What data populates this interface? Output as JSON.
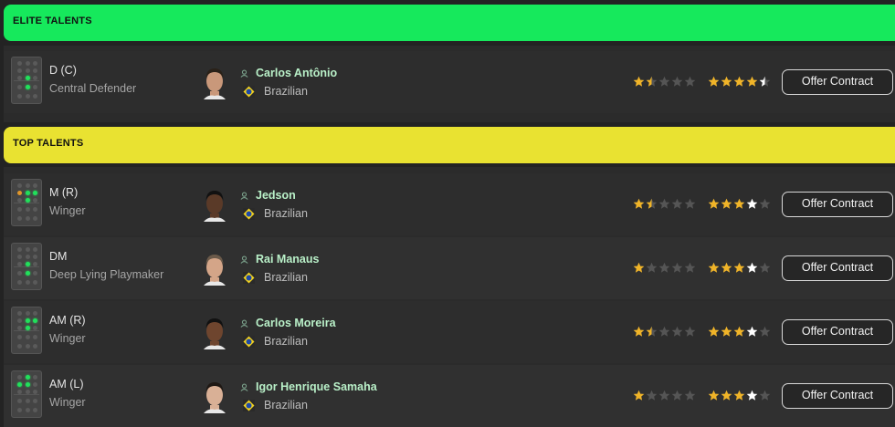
{
  "sections": {
    "elite": {
      "title": "ELITE TALENTS"
    },
    "top": {
      "title": "TOP TALENTS"
    }
  },
  "colors": {
    "elite_header": "#16e95c",
    "top_header": "#e9e231",
    "player_name": "#b9f0c8",
    "star_filled": "#f0b428",
    "star_empty": "#555555",
    "star_white": "#ffffff"
  },
  "icons": {
    "person": "person-icon",
    "flag": "brazil-flag-icon",
    "formation": "formation-icon",
    "star": "star-icon"
  },
  "offer_label": "Offer Contract",
  "players": [
    {
      "position": "D (C)",
      "role": "Central Defender",
      "name": "Carlos Antônio",
      "nationality": "Brazilian",
      "current_ability_stars": 1.5,
      "potential_ability_stars": 4.5
    },
    {
      "position": "M (R)",
      "role": "Winger",
      "name": "Jedson",
      "nationality": "Brazilian",
      "current_ability_stars": 1.5,
      "potential_ability_stars": 4
    },
    {
      "position": "DM",
      "role": "Deep Lying Playmaker",
      "name": "Rai Manaus",
      "nationality": "Brazilian",
      "current_ability_stars": 1,
      "potential_ability_stars": 4
    },
    {
      "position": "AM (R)",
      "role": "Winger",
      "name": "Carlos Moreira",
      "nationality": "Brazilian",
      "current_ability_stars": 1.5,
      "potential_ability_stars": 4
    },
    {
      "position": "AM (L)",
      "role": "Winger",
      "name": "Igor Henrique Samaha",
      "nationality": "Brazilian",
      "current_ability_stars": 1,
      "potential_ability_stars": 4
    }
  ]
}
